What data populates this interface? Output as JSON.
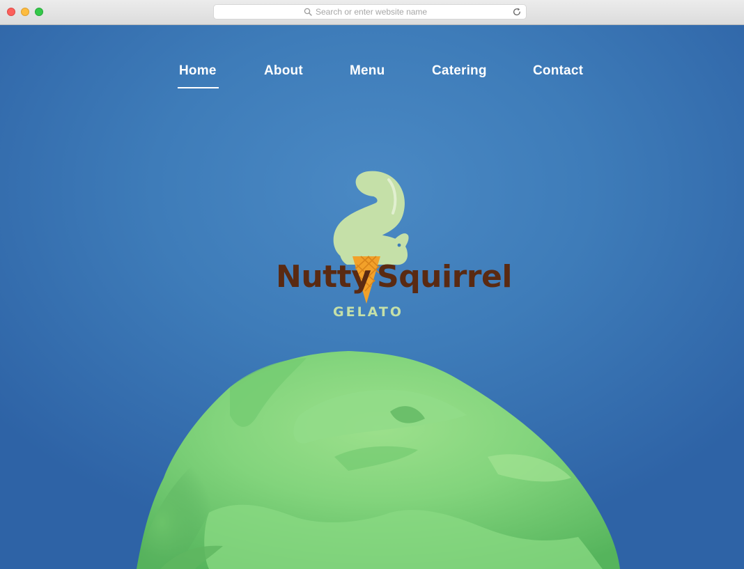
{
  "browser": {
    "address_placeholder": "Search or enter website name",
    "icons": [
      "search-icon",
      "reload-icon"
    ],
    "traffic_lights": [
      "close",
      "minimize",
      "maximize"
    ]
  },
  "nav": {
    "items": [
      {
        "label": "Home",
        "active": true
      },
      {
        "label": "About",
        "active": false
      },
      {
        "label": "Menu",
        "active": false
      },
      {
        "label": "Catering",
        "active": false
      },
      {
        "label": "Contact",
        "active": false
      }
    ]
  },
  "logo": {
    "word_left": "Nutty",
    "word_right": "Squirrel",
    "tagline": "GELATO"
  },
  "colors": {
    "background": "#3f7cb8",
    "nav_text": "#ffffff",
    "logo_brown": "#5a2a12",
    "logo_green": "#c5e0a8",
    "cone_orange": "#f2a12a",
    "gelato_green": "#7ed37a"
  }
}
